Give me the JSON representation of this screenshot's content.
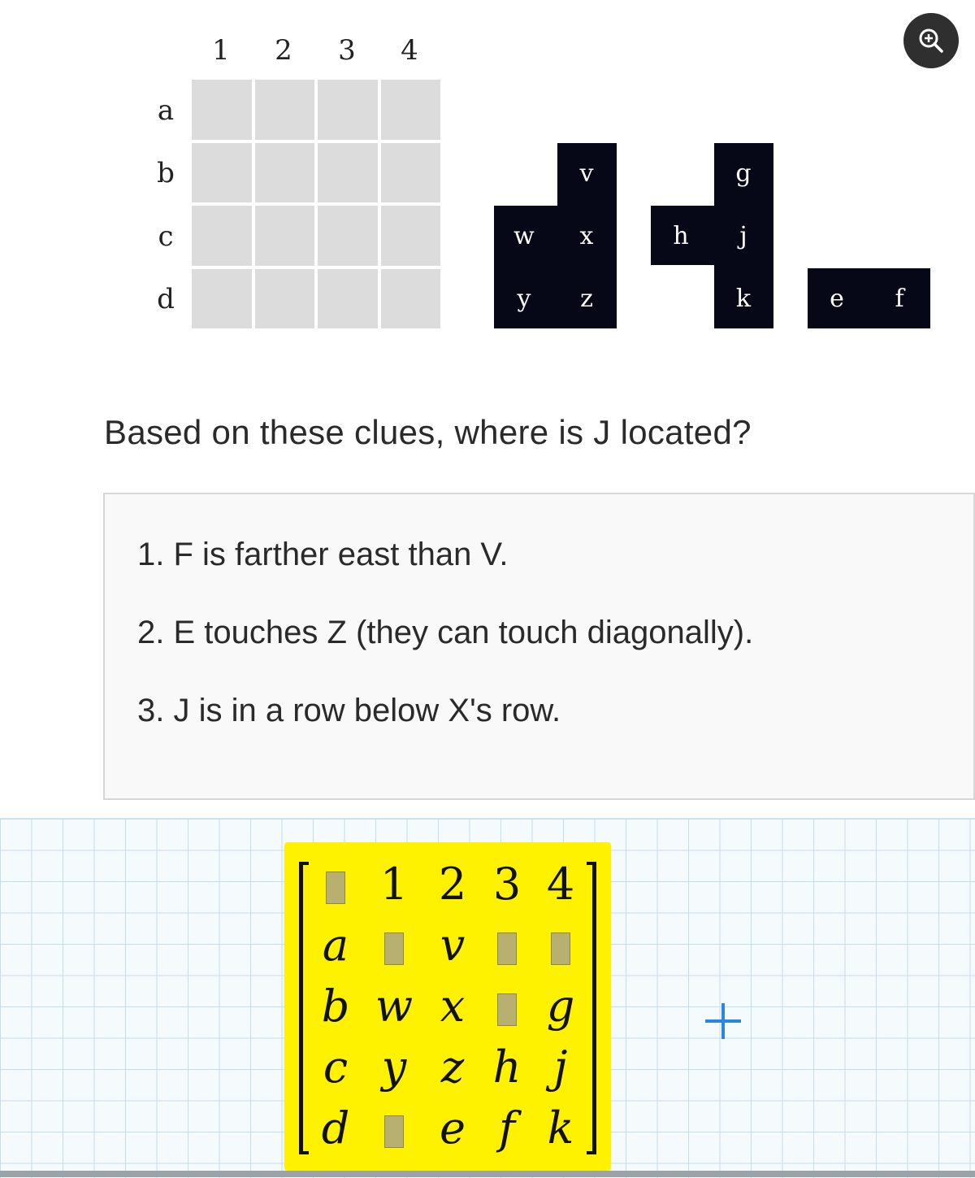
{
  "zoom": {
    "icon": "zoom-in-icon"
  },
  "grid": {
    "col_labels": [
      "1",
      "2",
      "3",
      "4"
    ],
    "row_labels": [
      "a",
      "b",
      "c",
      "d"
    ]
  },
  "pieces": [
    {
      "name": "piece-vwxyz",
      "labels": [
        "v",
        "w",
        "x",
        "y",
        "z"
      ]
    },
    {
      "name": "piece-ghjk",
      "labels": [
        "g",
        "h",
        "j",
        "k"
      ]
    },
    {
      "name": "piece-ef",
      "labels": [
        "e",
        "f"
      ]
    }
  ],
  "question": "Based on these clues, where is J located?",
  "clues": [
    "1. F is farther east than V.",
    "2. E touches Z (they can touch diagonally).",
    "3. J is in a row below X's row."
  ],
  "matrix": {
    "rows": [
      [
        "",
        "1",
        "2",
        "3",
        "4"
      ],
      [
        "a",
        "",
        "v",
        "",
        ""
      ],
      [
        "b",
        "w",
        "x",
        "",
        "g"
      ],
      [
        "c",
        "y",
        "z",
        "h",
        "j"
      ],
      [
        "d",
        "",
        "e",
        "f",
        "k"
      ]
    ],
    "highlight_color": "#fff200"
  },
  "add_button": {
    "icon": "plus-icon"
  }
}
